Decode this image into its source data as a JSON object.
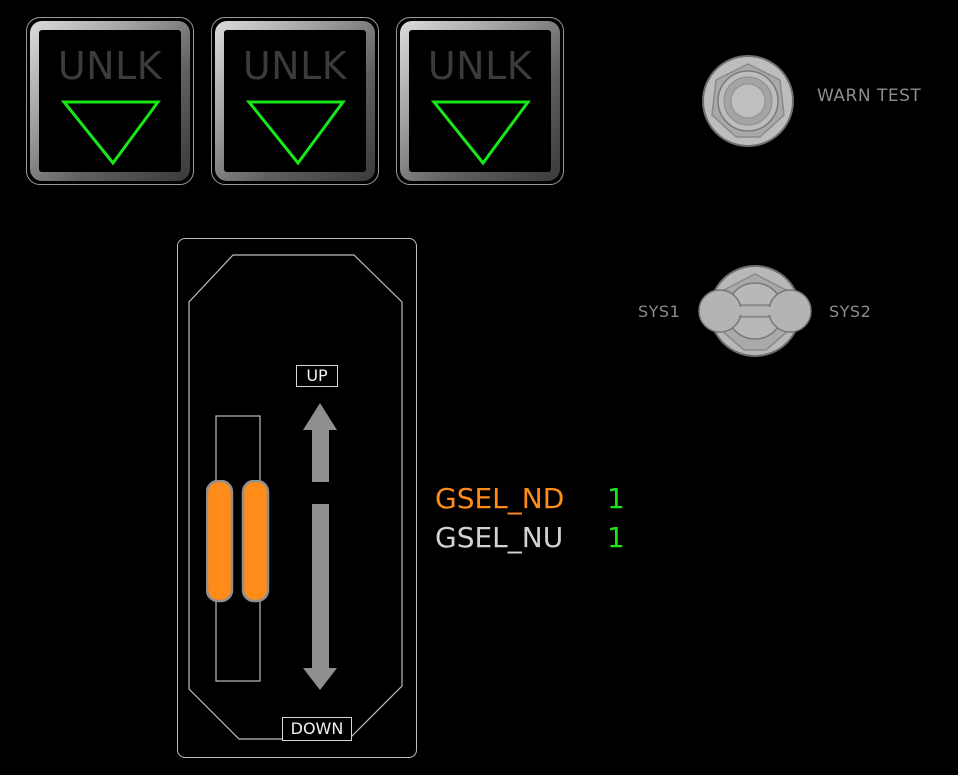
{
  "gear_indicators": [
    {
      "id": "left",
      "label": "UNLK"
    },
    {
      "id": "nose",
      "label": "UNLK"
    },
    {
      "id": "right",
      "label": "UNLK"
    }
  ],
  "warn_test": {
    "label": "WARN TEST",
    "icon": "pushbutton-icon"
  },
  "sys_switch": {
    "left_label": "SYS1",
    "right_label": "SYS2",
    "icon": "toggle-switch-icon"
  },
  "gear_lever": {
    "up_label": "UP",
    "down_label": "DOWN",
    "position": "down"
  },
  "status": [
    {
      "name": "GSEL_ND",
      "value": "1",
      "name_color": "#ff8c1a"
    },
    {
      "name": "GSEL_NU",
      "value": "1",
      "name_color": "#d2d2d2"
    }
  ],
  "colors": {
    "indicator_green": "#19e619",
    "handle_orange": "#ff8c1a",
    "value_green": "#19e619"
  }
}
